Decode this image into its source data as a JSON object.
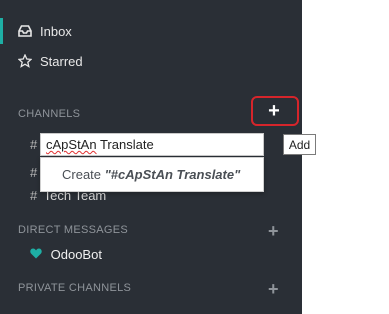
{
  "sidebar": {
    "inbox": {
      "label": "Inbox",
      "icon": "inbox-icon"
    },
    "starred": {
      "label": "Starred",
      "icon": "star-icon"
    },
    "channels": {
      "title": "CHANNELS",
      "add_glyph": "+",
      "add_tooltip": "Add",
      "items": [
        {
          "hash": "#",
          "label": ""
        },
        {
          "hash": "#",
          "label": ""
        },
        {
          "hash": "#",
          "label": "Tech Team"
        }
      ],
      "new_channel_input": {
        "value_prefix": "cApStAn",
        "value_suffix": " Translate"
      },
      "create_suggestion": {
        "prefix": "Create ",
        "quoted": "\"#cApStAn Translate\""
      }
    },
    "direct_messages": {
      "title": "DIRECT MESSAGES",
      "add_glyph": "+",
      "items": [
        {
          "label": "OdooBot",
          "icon": "heart-icon",
          "color": "#1eafa5"
        }
      ]
    },
    "private_channels": {
      "title": "PRIVATE CHANNELS",
      "add_glyph": "+"
    }
  },
  "colors": {
    "sidebar_bg": "#2a2f36",
    "accent": "#1eafa5",
    "highlight_red": "#d6252b"
  }
}
